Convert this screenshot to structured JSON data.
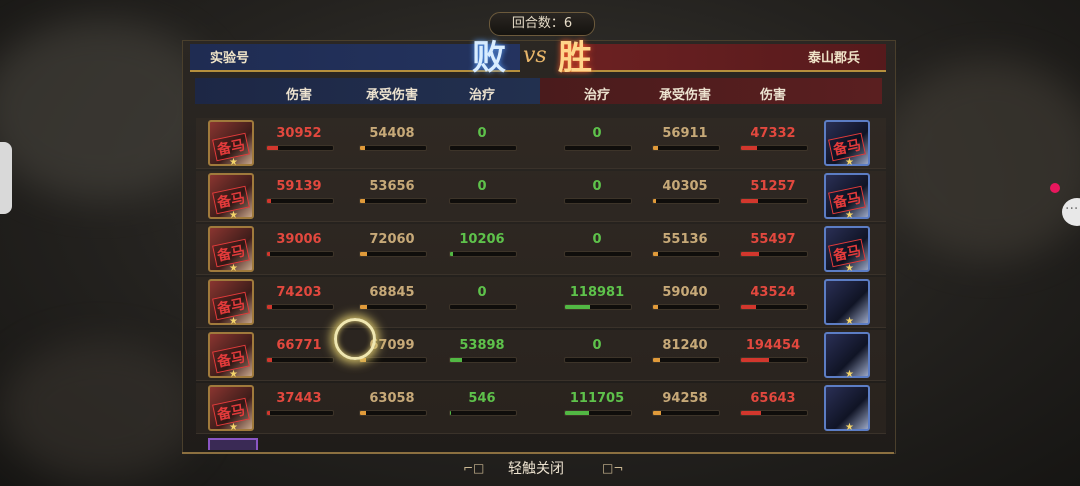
{
  "round": {
    "text": "回合数：6"
  },
  "teams": {
    "left_name": "实验号",
    "right_name": "泰山郡兵"
  },
  "result": {
    "left": "败",
    "vs": "vs",
    "right": "胜"
  },
  "columns": {
    "left": [
      "伤害",
      "承受伤害",
      "治疗"
    ],
    "right": [
      "治疗",
      "承受伤害",
      "伤害"
    ]
  },
  "rows": [
    {
      "l_dmg": "30952",
      "l_taken": "54408",
      "l_heal": "0",
      "r_heal": "0",
      "r_taken": "56911",
      "r_dmg": "47332",
      "l_dmg_f": 0.16,
      "l_taken_f": 0.08,
      "l_heal_f": 0,
      "r_heal_f": 0,
      "r_taken_f": 0.08,
      "r_dmg_f": 0.24
    },
    {
      "l_dmg": "59139",
      "l_taken": "53656",
      "l_heal": "0",
      "r_heal": "0",
      "r_taken": "40305",
      "r_dmg": "51257",
      "l_dmg_f": 0.06,
      "l_taken_f": 0.08,
      "l_heal_f": 0,
      "r_heal_f": 0,
      "r_taken_f": 0.05,
      "r_dmg_f": 0.26
    },
    {
      "l_dmg": "39006",
      "l_taken": "72060",
      "l_heal": "10206",
      "r_heal": "0",
      "r_taken": "55136",
      "r_dmg": "55497",
      "l_dmg_f": 0.05,
      "l_taken_f": 0.1,
      "l_heal_f": 0.05,
      "r_heal_f": 0,
      "r_taken_f": 0.08,
      "r_dmg_f": 0.28
    },
    {
      "l_dmg": "74203",
      "l_taken": "68845",
      "l_heal": "0",
      "r_heal": "118981",
      "r_taken": "59040",
      "r_dmg": "43524",
      "l_dmg_f": 0.08,
      "l_taken_f": 0.1,
      "l_heal_f": 0,
      "r_heal_f": 0.38,
      "r_taken_f": 0.08,
      "r_dmg_f": 0.22
    },
    {
      "l_dmg": "66771",
      "l_taken": "67099",
      "l_heal": "53898",
      "r_heal": "0",
      "r_taken": "81240",
      "r_dmg": "194454",
      "l_dmg_f": 0.07,
      "l_taken_f": 0.09,
      "l_heal_f": 0.18,
      "r_heal_f": 0,
      "r_taken_f": 0.1,
      "r_dmg_f": 0.42
    },
    {
      "l_dmg": "37443",
      "l_taken": "63058",
      "l_heal": "546",
      "r_heal": "111705",
      "r_taken": "94258",
      "r_dmg": "65643",
      "l_dmg_f": 0.05,
      "l_taken_f": 0.09,
      "l_heal_f": 0.01,
      "r_heal_f": 0.36,
      "r_taken_f": 0.12,
      "r_dmg_f": 0.3
    }
  ],
  "stamp": "备马",
  "footer": {
    "close": "轻触关闭"
  }
}
